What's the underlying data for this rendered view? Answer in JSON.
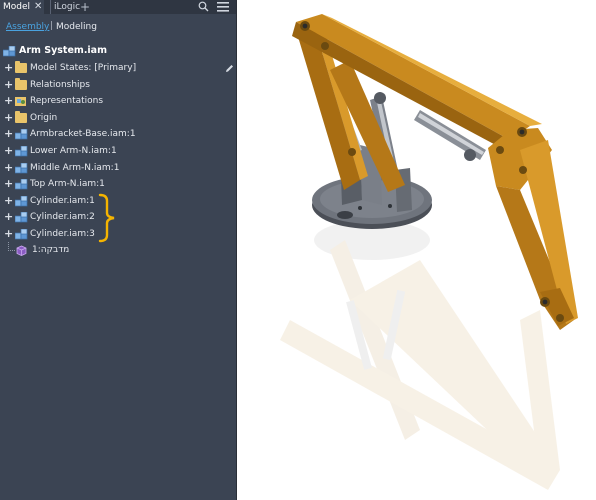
{
  "tabs": {
    "model": "Model",
    "logic": "iLogic",
    "add": "+"
  },
  "subtabs": {
    "assembly": "Assembly",
    "modeling": "Modeling"
  },
  "tree": {
    "root": "Arm System.iam",
    "items": [
      {
        "label": "Model States: [Primary]",
        "icon": "folder-icon"
      },
      {
        "label": "Relationships",
        "icon": "folder-icon"
      },
      {
        "label": "Representations",
        "icon": "representations-icon"
      },
      {
        "label": "Origin",
        "icon": "folder-icon"
      },
      {
        "label": "Armbracket-Base.iam:1",
        "icon": "subassembly-icon"
      },
      {
        "label": "Lower Arm-N.iam:1",
        "icon": "subassembly-icon"
      },
      {
        "label": "Middle Arm-N.iam:1",
        "icon": "subassembly-icon"
      },
      {
        "label": "Top Arm-N.iam:1",
        "icon": "subassembly-icon"
      },
      {
        "label": "Cylinder.iam:1",
        "icon": "subassembly-icon"
      },
      {
        "label": "Cylinder.iam:2",
        "icon": "subassembly-icon"
      },
      {
        "label": "Cylinder.iam:3",
        "icon": "subassembly-icon"
      },
      {
        "label": "מדבקה:1",
        "icon": "part-icon"
      }
    ]
  },
  "colors": {
    "panel_bg": "#3b4453",
    "accent": "#4aa3e0",
    "highlight_bracket": "#f5b400",
    "arm_orange": "#c98a1f"
  }
}
